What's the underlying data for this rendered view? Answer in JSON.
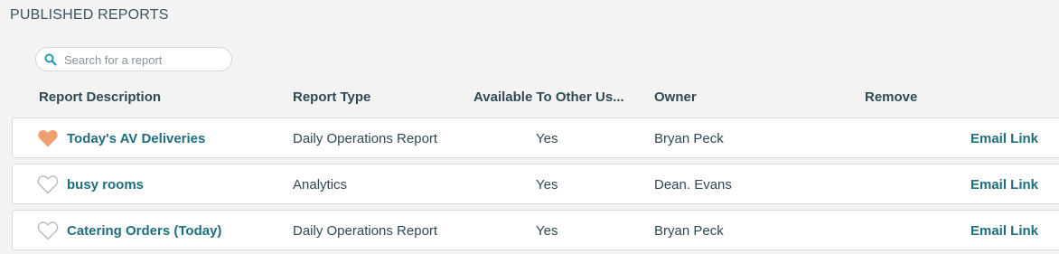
{
  "page": {
    "title": "PUBLISHED REPORTS"
  },
  "search": {
    "placeholder": "Search for a report",
    "value": ""
  },
  "columns": {
    "description": "Report Description",
    "type": "Report Type",
    "available": "Available To Other Us...",
    "owner": "Owner",
    "remove": "Remove"
  },
  "rows": [
    {
      "name": "Today's AV Deliveries",
      "type": "Daily Operations Report",
      "available": "Yes",
      "owner": "Bryan Peck",
      "action": "Email Link",
      "favorite": true
    },
    {
      "name": "busy rooms",
      "type": "Analytics",
      "available": "Yes",
      "owner": "Dean. Evans",
      "action": "Email Link",
      "favorite": false
    },
    {
      "name": "Catering Orders (Today)",
      "type": "Daily Operations Report",
      "available": "Yes",
      "owner": "Bryan Peck",
      "action": "Email Link",
      "favorite": false
    }
  ],
  "colors": {
    "favorite": "#f0a070",
    "link": "#1e6e80",
    "text": "#2f4a55",
    "search_icon": "#1f9bb0"
  },
  "icons": {
    "search": "search-icon",
    "favorite_on": "heart-filled-icon",
    "favorite_off": "heart-outline-icon"
  }
}
